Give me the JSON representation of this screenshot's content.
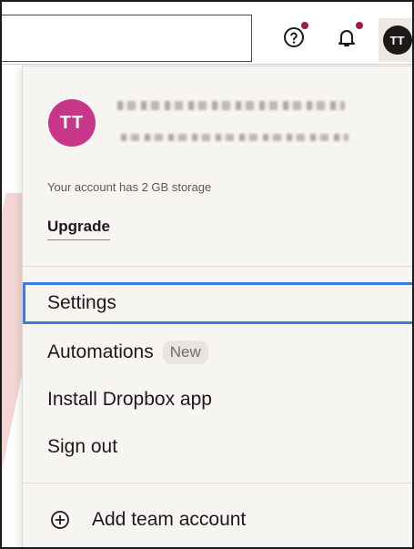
{
  "topbar": {
    "help_icon": "help-circle-icon",
    "notification_icon": "bell-icon",
    "notification_dot_color": "#9c1d3c",
    "avatar_initials": "TT"
  },
  "account_menu": {
    "avatar_initials": "TT",
    "avatar_color": "#c8368a",
    "storage_text": "Your account has 2 GB storage",
    "upgrade_label": "Upgrade",
    "items": [
      {
        "label": "Settings",
        "focused": true
      },
      {
        "label": "Automations",
        "badge": "New"
      },
      {
        "label": "Install Dropbox app"
      },
      {
        "label": "Sign out"
      }
    ],
    "add_team_account_label": "Add team account",
    "add_icon": "plus-circle-icon"
  },
  "colors": {
    "focus_ring": "#3a7ae2",
    "menu_background": "#f7f5f2"
  }
}
